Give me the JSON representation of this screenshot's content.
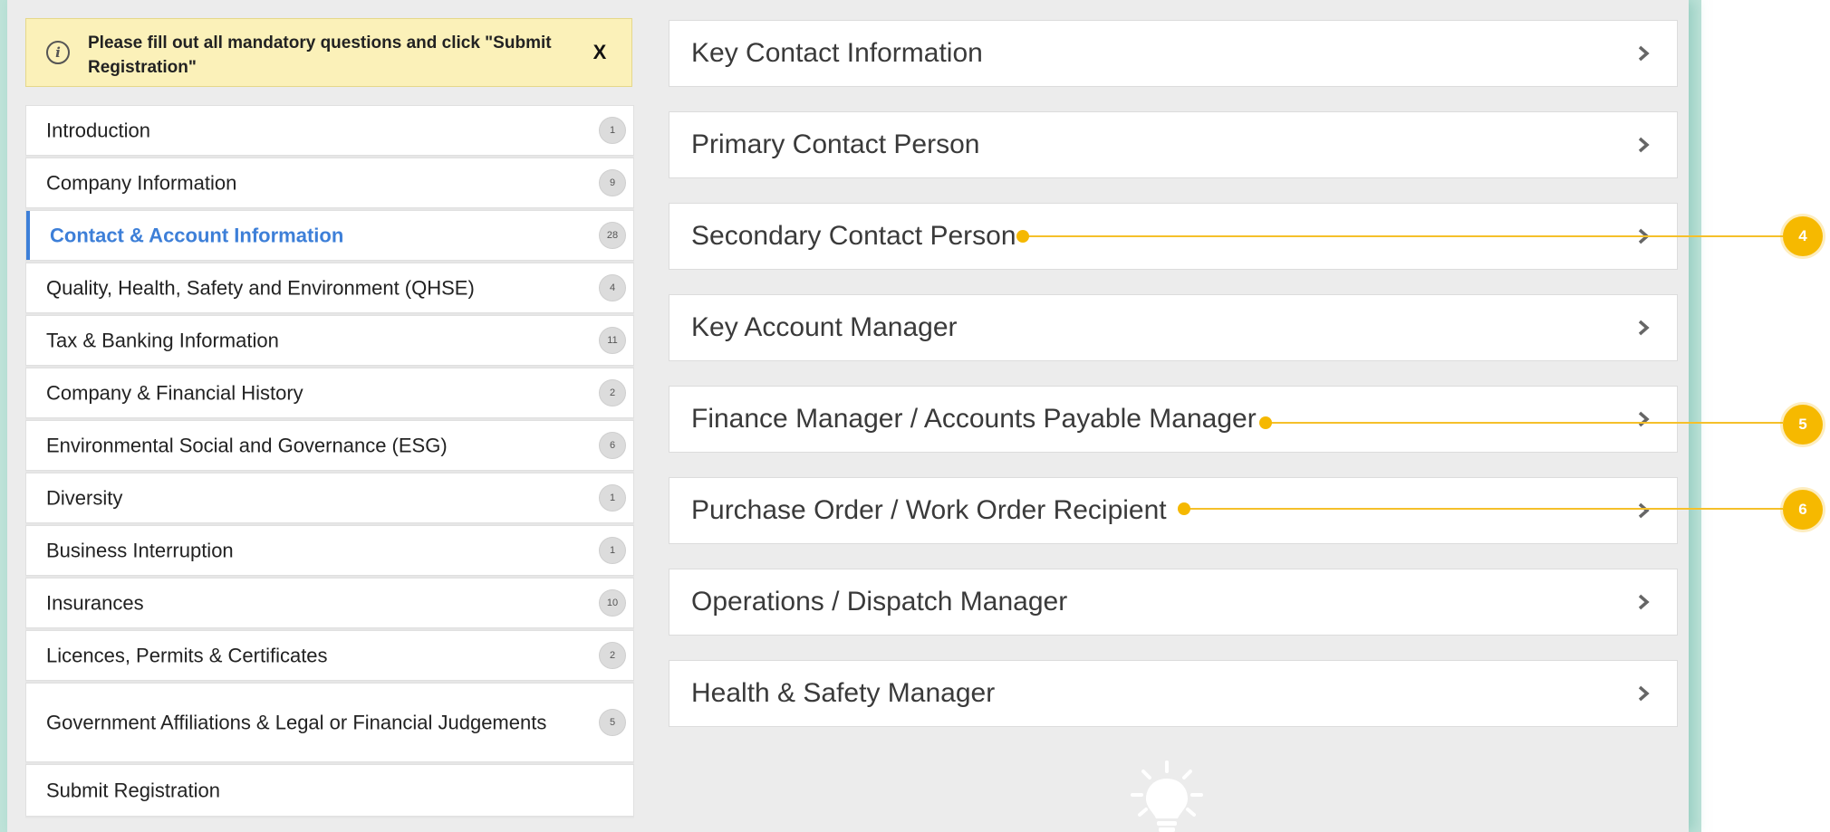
{
  "notice": {
    "text": "Please fill out all mandatory questions and click \"Submit Registration\"",
    "close_label": "X"
  },
  "sidebar": {
    "items": [
      {
        "label": "Introduction",
        "count": "1"
      },
      {
        "label": "Company Information",
        "count": "9"
      },
      {
        "label": "Contact & Account Information",
        "count": "28",
        "active": true
      },
      {
        "label": "Quality, Health, Safety and Environment (QHSE)",
        "count": "4"
      },
      {
        "label": "Tax & Banking Information",
        "count": "11"
      },
      {
        "label": "Company & Financial History",
        "count": "2"
      },
      {
        "label": "Environmental Social and Governance (ESG)",
        "count": "6"
      },
      {
        "label": "Diversity",
        "count": "1"
      },
      {
        "label": "Business Interruption",
        "count": "1"
      },
      {
        "label": "Insurances",
        "count": "10"
      },
      {
        "label": "Licences, Permits & Certificates",
        "count": "2"
      },
      {
        "label": "Government Affiliations & Legal or Financial Judgements",
        "count": "5"
      },
      {
        "label": "Submit Registration",
        "count": ""
      }
    ]
  },
  "main": {
    "sections": [
      {
        "label": "Key Contact Information"
      },
      {
        "label": "Primary Contact Person"
      },
      {
        "label": "Secondary Contact Person"
      },
      {
        "label": "Key Account Manager"
      },
      {
        "label": "Finance Manager / Accounts Payable Manager"
      },
      {
        "label": "Purchase Order / Work Order Recipient"
      },
      {
        "label": "Operations / Dispatch Manager"
      },
      {
        "label": "Health & Safety Manager"
      }
    ]
  },
  "callouts": [
    {
      "number": "4"
    },
    {
      "number": "5"
    },
    {
      "number": "6"
    }
  ],
  "colors": {
    "accent_blue": "#3d7fd8",
    "callout_yellow": "#f6b900",
    "notice_bg": "#fbf1b9",
    "panel_bg": "#ececec"
  },
  "icons": {
    "notice": "info-icon",
    "rows": "chevron-right-icon",
    "footer": "lightbulb-icon"
  }
}
